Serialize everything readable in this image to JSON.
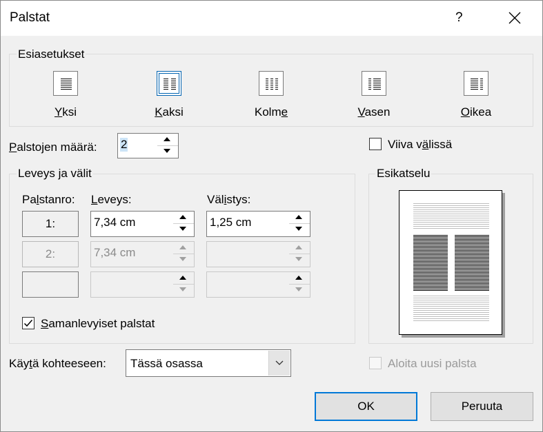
{
  "dialog": {
    "title": "Palstat",
    "help": "?",
    "close_icon": "close-icon"
  },
  "presets": {
    "group_label": "Esiasetukset",
    "items": [
      {
        "pre": "",
        "u": "Y",
        "post": "ksi"
      },
      {
        "pre": "",
        "u": "K",
        "post": "aksi"
      },
      {
        "pre": "Kolm",
        "u": "e",
        "post": ""
      },
      {
        "pre": "",
        "u": "V",
        "post": "asen"
      },
      {
        "pre": "",
        "u": "O",
        "post": "ikea"
      }
    ]
  },
  "number_of_columns": {
    "pre": "",
    "u": "P",
    "post": "alstojen määrä:",
    "value": "2"
  },
  "line_between": {
    "pre": "Viiva v",
    "u": "ä",
    "post": "lissä",
    "checked": false
  },
  "width_spacing": {
    "group_label": "Leveys ja välit",
    "col_header": {
      "pre": "Pa",
      "u": "l",
      "post": "stanro:"
    },
    "width_header": {
      "pre": "",
      "u": "L",
      "post": "eveys:"
    },
    "spacing_header": {
      "pre": "Väl",
      "u": "i",
      "post": "stys:"
    },
    "rows": [
      {
        "col": "1:",
        "width": "7,34 cm",
        "spacing": "1,25 cm"
      },
      {
        "col": "2:",
        "width": "7,34 cm",
        "spacing": ""
      },
      {
        "col": "",
        "width": "",
        "spacing": ""
      }
    ]
  },
  "equal_width": {
    "pre": "",
    "u": "S",
    "post": "amanlevyiset palstat",
    "checked": true
  },
  "preview": {
    "group_label": "Esikatselu"
  },
  "apply_to": {
    "pre": "Käy",
    "u": "t",
    "post": "ä kohteeseen:",
    "value": "Tässä osassa"
  },
  "start_new_column": {
    "label": "Aloita uusi palsta",
    "checked": false
  },
  "buttons": {
    "ok": "OK",
    "cancel": "Peruuta"
  }
}
